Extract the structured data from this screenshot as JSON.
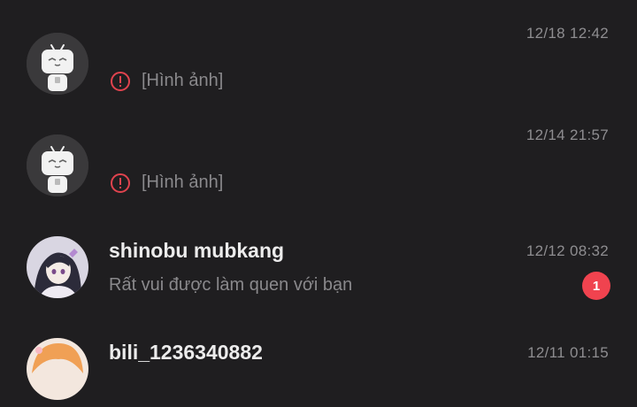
{
  "conversations": [
    {
      "avatar": "default-tv-mascot-avatar",
      "name": "",
      "time": "12/18 12:42",
      "preview": "[Hình ảnh]",
      "preview_icon": "alert-circle-icon",
      "unread": null
    },
    {
      "avatar": "default-tv-mascot-avatar",
      "name": "",
      "time": "12/14 21:57",
      "preview": "[Hình ảnh]",
      "preview_icon": "alert-circle-icon",
      "unread": null
    },
    {
      "avatar": "anime-character-avatar",
      "name": "shinobu mubkang",
      "time": "12/12 08:32",
      "preview": "Rất vui được làm quen với bạn",
      "unread": "1"
    },
    {
      "avatar": "orange-hair-character-avatar",
      "name": "bili_1236340882",
      "time": "12/11 01:15",
      "preview": "",
      "unread": null
    }
  ],
  "colors": {
    "background": "#1f1e20",
    "accent_red": "#f0434f",
    "secondary_text": "#8e8d90"
  }
}
